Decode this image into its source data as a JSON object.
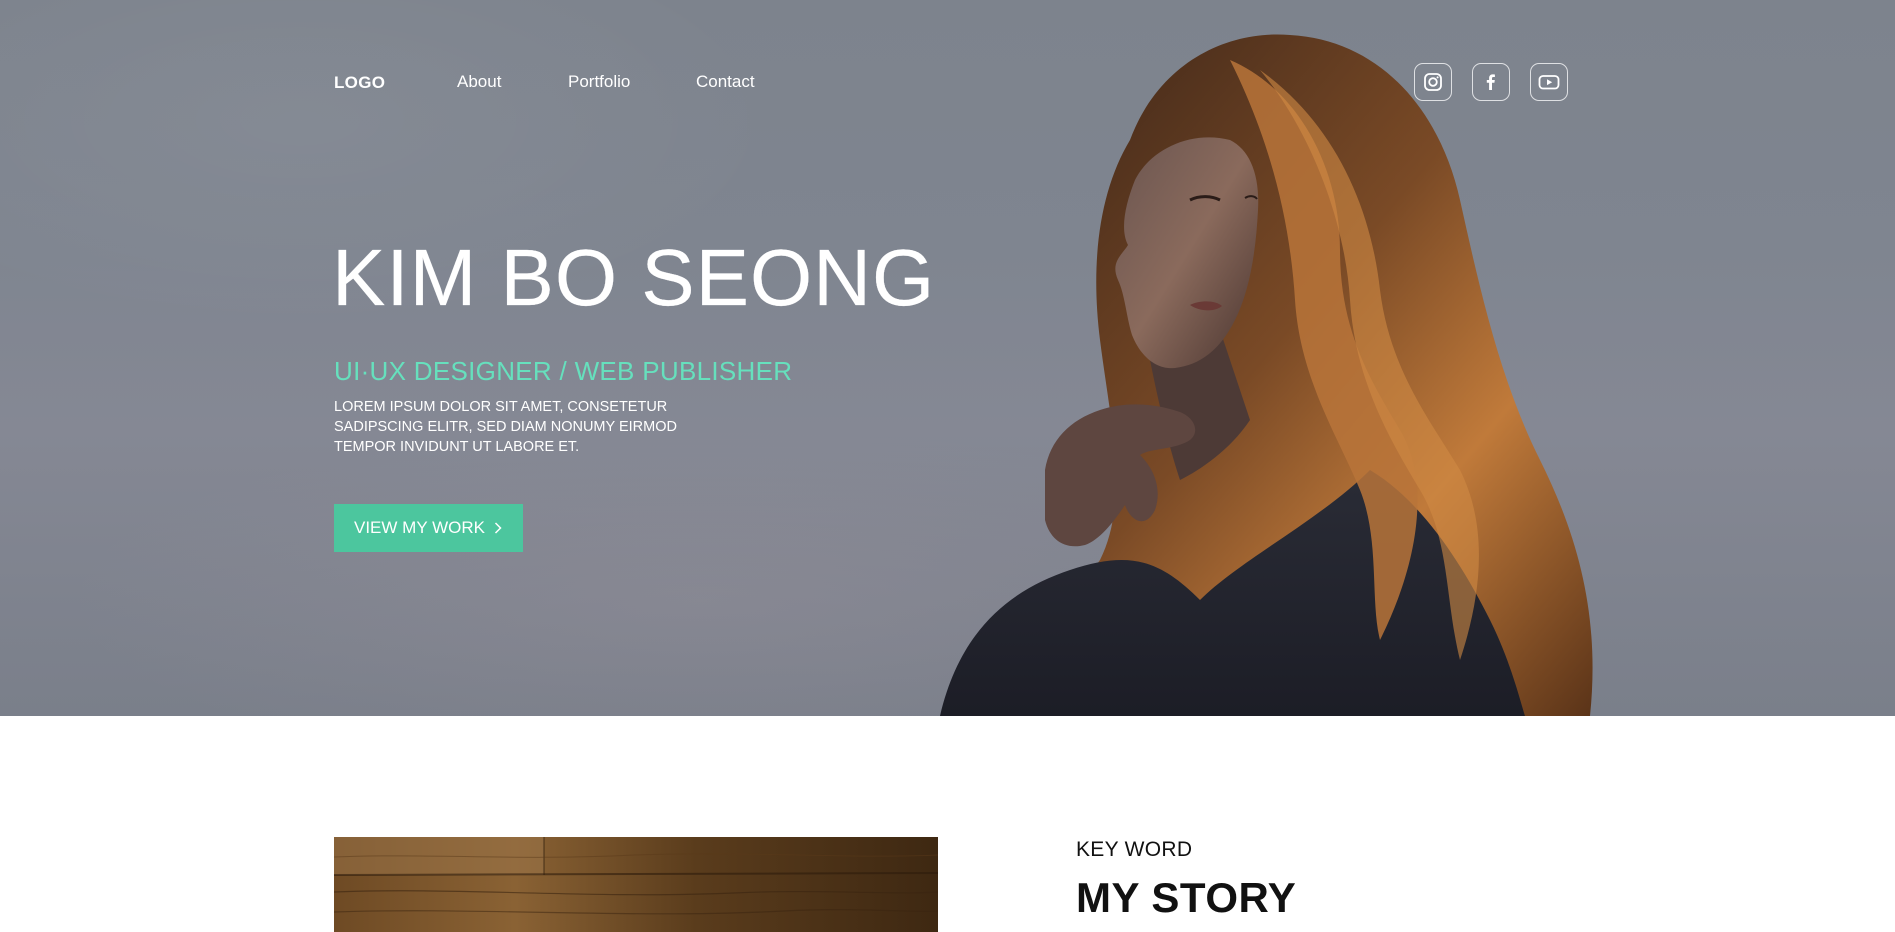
{
  "nav": {
    "logo": "LOGO",
    "links": [
      "About",
      "Portfolio",
      "Contact"
    ]
  },
  "social": [
    {
      "icon": "instagram-icon"
    },
    {
      "icon": "facebook-icon"
    },
    {
      "icon": "youtube-icon"
    }
  ],
  "hero": {
    "name": "KIM BO SEONG",
    "role": "UI·UX DESIGNER / WEB PUBLISHER",
    "description": "LOREM IPSUM DOLOR SIT AMET, CONSETETUR SADIPSCING ELITR, SED DIAM NONUMY EIRMOD TEMPOR INVIDUNT UT LABORE ET.",
    "cta_label": "VIEW MY WORK",
    "cta_icon": "chevron-right-icon"
  },
  "story": {
    "keyword": "KEY WORD",
    "title": "MY STORY"
  },
  "colors": {
    "accent": "#66e0bd",
    "button": "#4cc69e",
    "hero_bg": "#7f8590"
  }
}
